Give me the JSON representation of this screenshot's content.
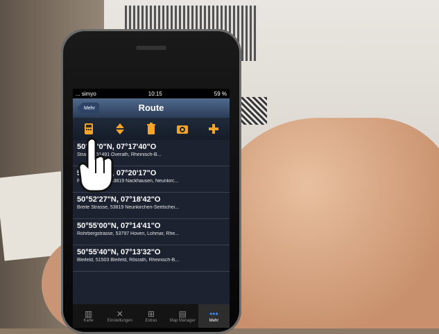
{
  "status": {
    "carrier": "... simyo",
    "time": "10:15",
    "battery": "59 %"
  },
  "nav": {
    "back_label": "Mehr",
    "title": "Route"
  },
  "toolbar": {
    "icons": [
      "calculator-icon",
      "sort-icon",
      "trash-icon",
      "map-pin-icon",
      "plus-icon"
    ]
  },
  "routes": [
    {
      "coord": "50°57'0\"N, 07°17'40\"O",
      "addr": "Strasse, 51491 Overath, Rheinisch-B..."
    },
    {
      "coord": "50°57'4\"N, 07°20'17\"O",
      "addr": "Frauenstrasse, 53819 Nackhausen, Neunkirc..."
    },
    {
      "coord": "50°52'27\"N, 07°18'42\"O",
      "addr": "Breite Strasse, 53819 Neunkirchen-Seelschei..."
    },
    {
      "coord": "50°55'00\"N, 07°14'41\"O",
      "addr": "Rohrbergstrasse, 53797 Hoven, Lohmar, Rhe..."
    },
    {
      "coord": "50°55'40\"N, 07°13'32\"O",
      "addr": "Bleifeld, 51503 Bleifeld, Rösrath, Rheinisch-B..."
    }
  ],
  "tabs": [
    {
      "label": "Karte",
      "icon": "map-icon"
    },
    {
      "label": "Einstellungen",
      "icon": "tools-icon"
    },
    {
      "label": "Extras",
      "icon": "cart-icon"
    },
    {
      "label": "Map Manager",
      "icon": "maps-icon"
    },
    {
      "label": "Mehr",
      "icon": "more-icon"
    }
  ]
}
